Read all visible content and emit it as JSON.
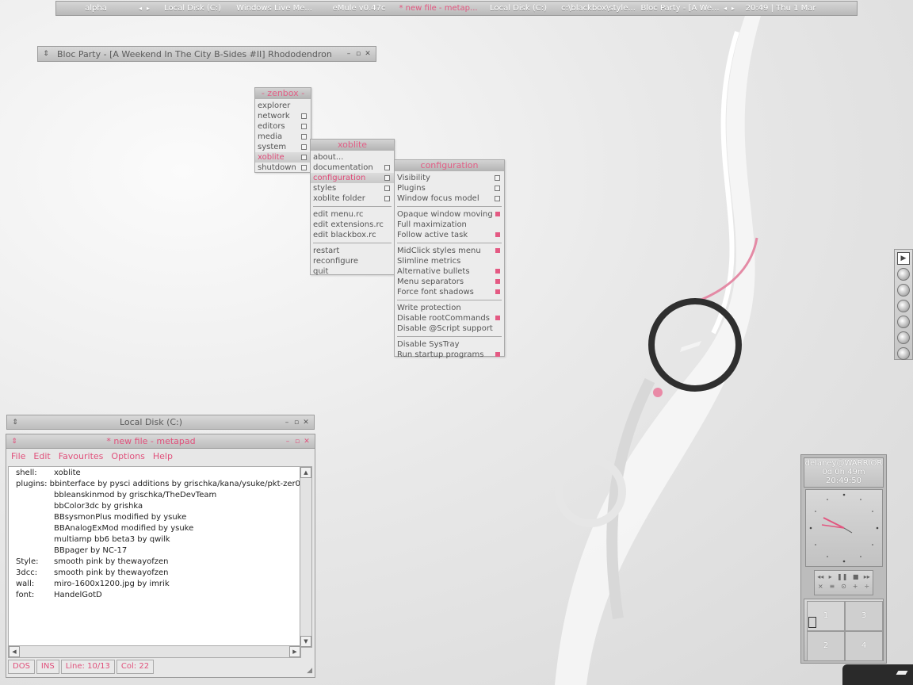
{
  "toolbar": {
    "workspace": "alpha",
    "tasks": [
      "Local Disk (C:)",
      "Windows Live Me...",
      "eMule v0.47c",
      "* new file - metap...",
      "Local Disk (C:)",
      "c:\\blackbox\\style...",
      "Bloc Party - [A We..."
    ],
    "clock": "20:49 | Thu 1 Mar"
  },
  "media_window": {
    "title": "Bloc Party - [A Weekend In The City B-Sides #II] Rhododendron"
  },
  "zenbox_menu": {
    "title": "- zenbox -",
    "items": [
      "explorer",
      "network",
      "editors",
      "media",
      "system",
      "xoblite",
      "shutdown"
    ]
  },
  "xoblite_menu": {
    "title": "xoblite",
    "items": [
      "about...",
      "documentation",
      "configuration",
      "styles",
      "xoblite folder",
      "edit menu.rc",
      "edit extensions.rc",
      "edit blackbox.rc",
      "restart",
      "reconfigure",
      "quit"
    ]
  },
  "config_menu": {
    "title": "configuration",
    "items": [
      "Visibility",
      "Plugins",
      "Window focus model",
      "Opaque window moving",
      "Full maximization",
      "Follow active task",
      "MidClick styles menu",
      "Slimline metrics",
      "Alternative bullets",
      "Menu separators",
      "Force font shadows",
      "Write protection",
      "Disable rootCommands",
      "Disable @Script support",
      "Disable SysTray",
      "Run startup programs"
    ]
  },
  "explorer_window": {
    "title": "Local Disk (C:)"
  },
  "metapad": {
    "title": "* new file - metapad",
    "menu": [
      "File",
      "Edit",
      "Favourites",
      "Options",
      "Help"
    ],
    "lines": [
      {
        "key": "shell:",
        "value": "xoblite"
      },
      {
        "key": "plugins:",
        "value": "bbinterface by pysci additions by grischka/kana/ysuke/pkt-zer0"
      },
      {
        "key": "",
        "value": "bbleanskinmod by grischka/TheDevTeam"
      },
      {
        "key": "",
        "value": "bbColor3dc by grishka"
      },
      {
        "key": "",
        "value": "BBsysmonPlus modified by ysuke"
      },
      {
        "key": "",
        "value": "BBAnalogExMod modified by ysuke"
      },
      {
        "key": "",
        "value": "multiamp bb6 beta3 by qwilk"
      },
      {
        "key": "",
        "value": "BBpager by NC-17"
      },
      {
        "key": "Style:",
        "value": "smooth pink by thewayofzen"
      },
      {
        "key": "3dcc:",
        "value": "smooth pink by thewayofzen"
      },
      {
        "key": "wall:",
        "value": "miro-1600x1200.jpg by imrik"
      },
      {
        "key": "font:",
        "value": "HandelGotD"
      }
    ],
    "status": [
      "DOS",
      "INS",
      "Line: 10/13",
      "Col: 22"
    ]
  },
  "sysmon": {
    "user": "delaney@WARRIOR",
    "uptime": "0d 0h 49m",
    "time": "20:49:50",
    "pager": [
      "1",
      "3",
      "2",
      "4"
    ]
  },
  "accent_color": "#e2567f"
}
